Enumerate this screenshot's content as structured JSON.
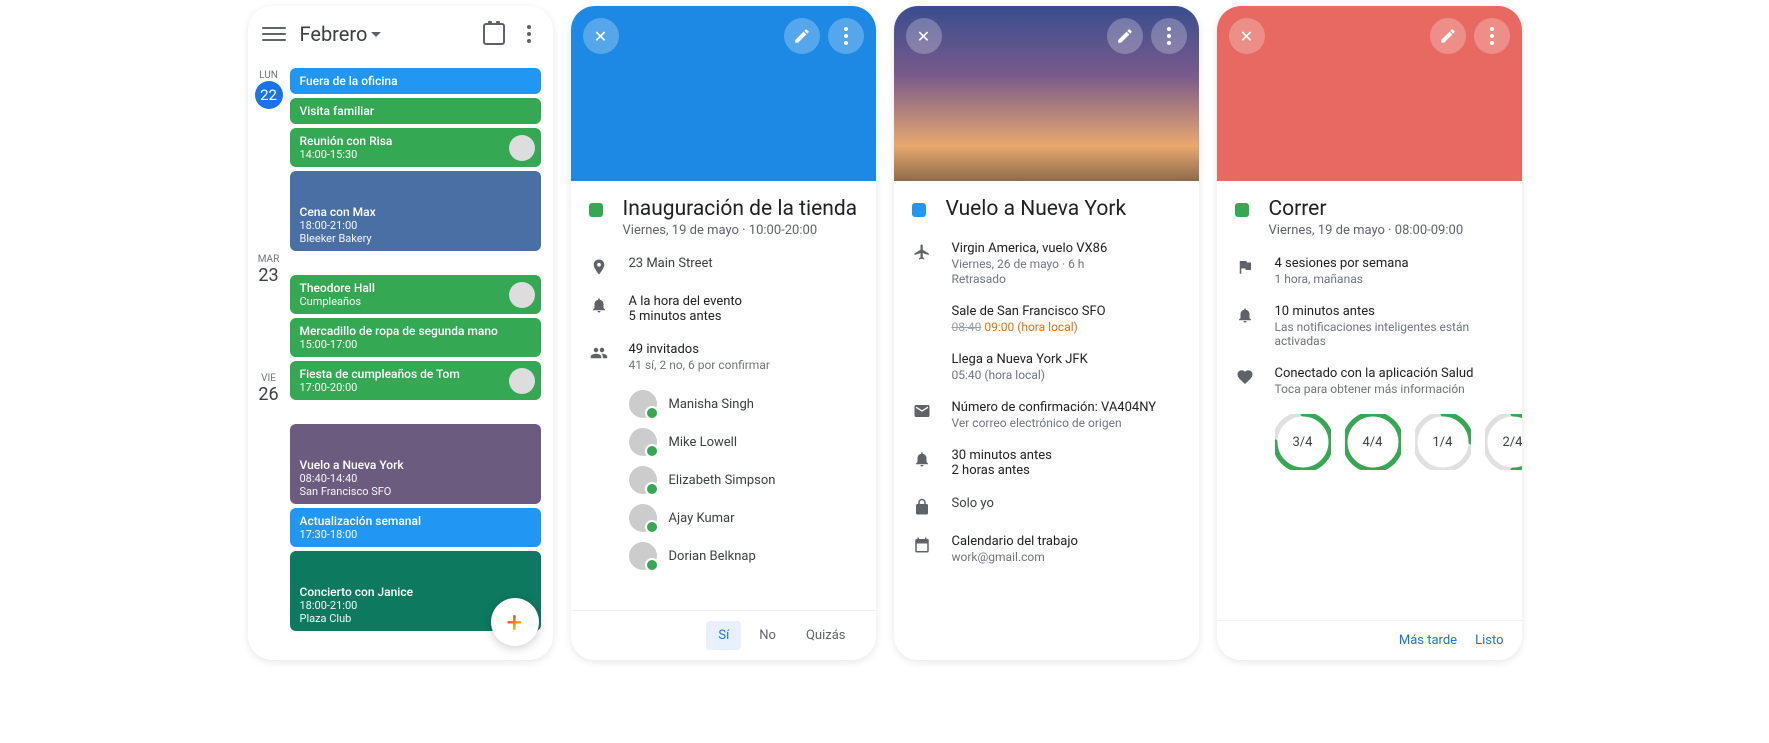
{
  "p1": {
    "month": "Febrero",
    "today": {
      "dow": "LUN",
      "num": "22"
    },
    "groups": [
      {
        "dow": "LUN",
        "num": "22",
        "today": true,
        "events": [
          {
            "color": "blue",
            "title": "Fuera de la oficina"
          },
          {
            "color": "green",
            "title": "Visita familiar"
          },
          {
            "color": "green",
            "title": "Reunión con Risa",
            "sub": "14:00-15:30",
            "avatar": true
          },
          {
            "color": "img",
            "title": "Cena con Max",
            "sub": "18:00-21:00",
            "sub2": "Bleeker Bakery",
            "bg": "#4a6fa5"
          }
        ]
      },
      {
        "dow": "MAR",
        "num": "23",
        "events": [
          {
            "color": "green",
            "title": "Theodore Hall",
            "sub": "Cumpleaños",
            "avatar": true
          },
          {
            "color": "green",
            "title": "Mercadillo de ropa de segunda mano",
            "sub": "15:00-17:00"
          },
          {
            "color": "green",
            "title": "Fiesta de cumpleaños de Tom",
            "sub": "17:00-20:00",
            "avatar": true
          }
        ]
      },
      {
        "dow": "VIE",
        "num": "26",
        "events": [
          {
            "color": "img",
            "title": "Vuelo a Nueva York",
            "sub": "08:40-14:40",
            "sub2": "San Francisco SFO",
            "bg": "#6b5b7e"
          },
          {
            "color": "blue",
            "title": "Actualización semanal",
            "sub": "17:30-18:00"
          },
          {
            "color": "img",
            "title": "Concierto con Janice",
            "sub": "18:00-21:00",
            "sub2": "Plaza Club",
            "bg": "#0d7a5f"
          }
        ]
      }
    ]
  },
  "p2": {
    "title": "Inauguración de la tienda",
    "subtitle": "Viernes, 19 de mayo · 10:00-20:00",
    "location": "23 Main Street",
    "reminders": [
      "A la hora del evento",
      "5 minutos antes"
    ],
    "guests_summary": "49 invitados",
    "guests_status": "41 sí, 2 no, 6 por confirmar",
    "guests": [
      "Manisha Singh",
      "Mike Lowell",
      "Elizabeth Simpson",
      "Ajay Kumar",
      "Dorian Belknap"
    ],
    "rsvp": [
      "Sí",
      "No",
      "Quizás"
    ]
  },
  "p3": {
    "title": "Vuelo a Nueva York",
    "airline": "Virgin America, vuelo VX86",
    "date_duration": "Viernes, 26 de mayo · 6 h",
    "status": "Retrasado",
    "dep": {
      "label": "Sale de San Francisco SFO",
      "orig": "08:40",
      "new": "09:00",
      "tz": "(hora local)"
    },
    "arr": {
      "label": "Llega a Nueva York JFK",
      "time": "05:40",
      "tz": "(hora local)"
    },
    "conf": "Número de confirmación: VA404NY",
    "conf_sub": "Ver correo electrónico de origen",
    "reminders": [
      "30 minutos antes",
      "2 horas antes"
    ],
    "visibility": "Solo yo",
    "cal": "Calendario del trabajo",
    "cal_email": "work@gmail.com"
  },
  "p4": {
    "title": "Correr",
    "subtitle": "Viernes, 19 de mayo · 08:00-09:00",
    "goal": "4 sesiones por semana",
    "goal_sub": "1 hora, mañanas",
    "reminder": "10 minutos antes",
    "reminder_sub": "Las notificaciones inteligentes están activadas",
    "health": "Conectado con la aplicación Salud",
    "health_sub": "Toca para obtener más información",
    "progress": [
      {
        "label": "3/4",
        "pct": 0.75
      },
      {
        "label": "4/4",
        "pct": 1
      },
      {
        "label": "1/4",
        "pct": 0.25
      },
      {
        "label": "2/4",
        "pct": 0.5
      }
    ],
    "actions": [
      "Más tarde",
      "Listo"
    ]
  }
}
